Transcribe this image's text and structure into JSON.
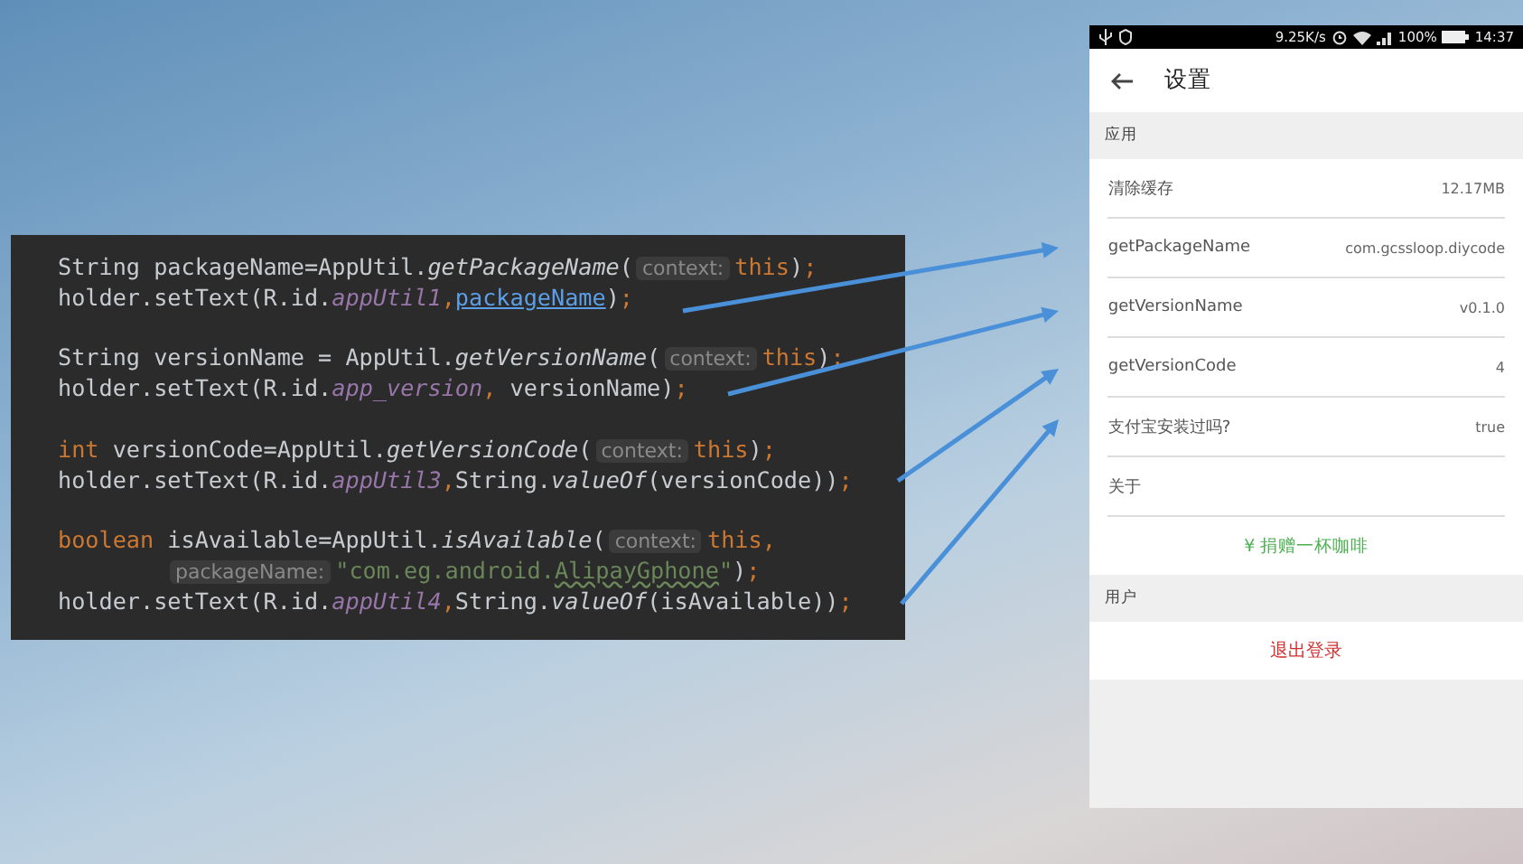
{
  "code_editor": {
    "lines": [
      {
        "tokens": [
          {
            "kind": "plain",
            "text": "String packageName=AppUtil."
          },
          {
            "kind": "method",
            "text": "getPackageName"
          },
          {
            "kind": "plain",
            "text": "("
          },
          {
            "kind": "hint",
            "text": "context:"
          },
          {
            "kind": "keyword",
            "text": "this"
          },
          {
            "kind": "plain",
            "text": ")"
          },
          {
            "kind": "keyword",
            "text": ";"
          }
        ]
      },
      {
        "tokens": [
          {
            "kind": "plain",
            "text": "holder.setText(R.id."
          },
          {
            "kind": "field",
            "text": "appUtil1"
          },
          {
            "kind": "keyword",
            "text": ","
          },
          {
            "kind": "link",
            "text": "packageName"
          },
          {
            "kind": "plain",
            "text": ")"
          },
          {
            "kind": "keyword",
            "text": ";"
          }
        ]
      },
      {
        "blank_before": true,
        "tokens": [
          {
            "kind": "plain",
            "text": "String versionName = AppUtil."
          },
          {
            "kind": "method",
            "text": "getVersionName"
          },
          {
            "kind": "plain",
            "text": "("
          },
          {
            "kind": "hint",
            "text": "context:"
          },
          {
            "kind": "keyword",
            "text": "this"
          },
          {
            "kind": "plain",
            "text": ")"
          },
          {
            "kind": "keyword",
            "text": ";"
          }
        ]
      },
      {
        "tokens": [
          {
            "kind": "plain",
            "text": "holder.setText(R.id."
          },
          {
            "kind": "field",
            "text": "app_version"
          },
          {
            "kind": "keyword",
            "text": ","
          },
          {
            "kind": "plain",
            "text": " versionName)"
          },
          {
            "kind": "keyword",
            "text": ";"
          }
        ]
      },
      {
        "blank_before": true,
        "tokens": [
          {
            "kind": "keyword",
            "text": "int"
          },
          {
            "kind": "plain",
            "text": " versionCode=AppUtil."
          },
          {
            "kind": "method",
            "text": "getVersionCode"
          },
          {
            "kind": "plain",
            "text": "("
          },
          {
            "kind": "hint",
            "text": "context:"
          },
          {
            "kind": "keyword",
            "text": "this"
          },
          {
            "kind": "plain",
            "text": ")"
          },
          {
            "kind": "keyword",
            "text": ";"
          }
        ]
      },
      {
        "tokens": [
          {
            "kind": "plain",
            "text": "holder.setText(R.id."
          },
          {
            "kind": "field",
            "text": "appUtil3"
          },
          {
            "kind": "keyword",
            "text": ","
          },
          {
            "kind": "plain",
            "text": "String."
          },
          {
            "kind": "method",
            "text": "valueOf"
          },
          {
            "kind": "plain",
            "text": "(versionCode))"
          },
          {
            "kind": "keyword",
            "text": ";"
          }
        ]
      },
      {
        "blank_before": true,
        "tokens": [
          {
            "kind": "keyword",
            "text": "boolean"
          },
          {
            "kind": "plain",
            "text": " isAvailable=AppUtil."
          },
          {
            "kind": "method",
            "text": "isAvailable"
          },
          {
            "kind": "plain",
            "text": "("
          },
          {
            "kind": "hint",
            "text": "context:"
          },
          {
            "kind": "keyword",
            "text": "this,"
          }
        ]
      },
      {
        "indented": true,
        "tokens": [
          {
            "kind": "hint",
            "text": "packageName:"
          },
          {
            "kind": "string",
            "text": "\"com.eg.android."
          },
          {
            "kind": "string-typo",
            "text": "AlipayGphone"
          },
          {
            "kind": "string",
            "text": "\""
          },
          {
            "kind": "plain",
            "text": ")"
          },
          {
            "kind": "keyword",
            "text": ";"
          }
        ]
      },
      {
        "tokens": [
          {
            "kind": "plain",
            "text": "holder.setText(R.id."
          },
          {
            "kind": "field",
            "text": "appUtil4"
          },
          {
            "kind": "keyword",
            "text": ","
          },
          {
            "kind": "plain",
            "text": "String."
          },
          {
            "kind": "method",
            "text": "valueOf"
          },
          {
            "kind": "plain",
            "text": "(isAvailable))"
          },
          {
            "kind": "keyword",
            "text": ";"
          }
        ]
      }
    ]
  },
  "phone": {
    "status_bar": {
      "speed": "9.25K/s",
      "battery": "100%",
      "time": "14:37"
    },
    "toolbar": {
      "title": "设置"
    },
    "sections": [
      {
        "header": "应用",
        "rows": [
          {
            "kind": "setting",
            "label": "清除缓存",
            "value": "12.17MB"
          },
          {
            "kind": "setting",
            "label": "getPackageName",
            "value": "com.gcssloop.diycode"
          },
          {
            "kind": "setting",
            "label": "getVersionName",
            "value": "v0.1.0"
          },
          {
            "kind": "setting",
            "label": "getVersionCode",
            "value": "4"
          },
          {
            "kind": "setting",
            "label": "支付宝安装过吗?",
            "value": "true"
          },
          {
            "kind": "setting",
            "label": "关于"
          },
          {
            "kind": "donate",
            "label": "¥ 捐赠一杯咖啡"
          }
        ]
      },
      {
        "header": "用户",
        "rows": [
          {
            "kind": "logout",
            "label": "退出登录"
          }
        ]
      }
    ]
  }
}
